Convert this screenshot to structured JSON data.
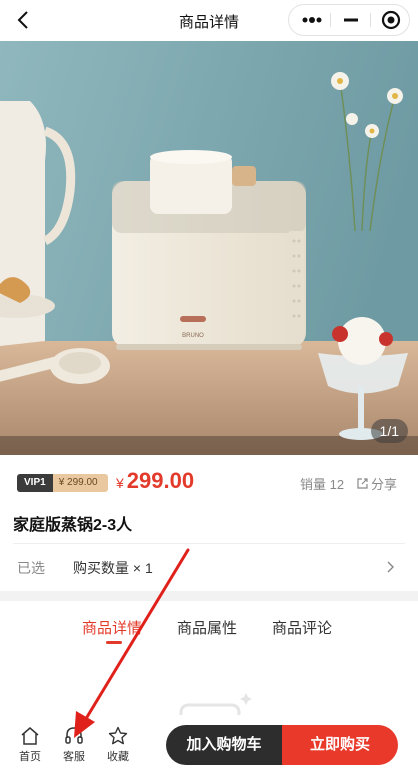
{
  "nav": {
    "title": "商品详情",
    "back_icon": "chevron-left-icon",
    "capsule_icons": [
      "more-dots-icon",
      "minimize-icon",
      "target-icon"
    ]
  },
  "gallery": {
    "pager": "1/1",
    "brand_on_product": "BRUNO"
  },
  "product": {
    "vip_tag": "VIP1",
    "vip_price": "¥ 299.00",
    "currency": "¥",
    "price": "299.00",
    "sales": "销量 12",
    "share": "分享",
    "name": "家庭版蒸锅2-3人",
    "selected_label": "已选",
    "selected_value": "购买数量 × 1"
  },
  "detail_tabs": [
    "商品详情",
    "商品属性",
    "商品评论"
  ],
  "active_tab": 0,
  "bottom_bar": {
    "items": [
      {
        "label": "首页",
        "icon": "home-icon"
      },
      {
        "label": "客服",
        "icon": "headset-icon"
      },
      {
        "label": "收藏",
        "icon": "star-icon"
      }
    ],
    "add_to_cart": "加入购物车",
    "buy_now": "立即购买"
  },
  "colors": {
    "accent": "#e33b2b",
    "dark": "#2d2d2d",
    "vip_gold": "#e9c8a0",
    "annotation_arrow": "#e0201a"
  }
}
